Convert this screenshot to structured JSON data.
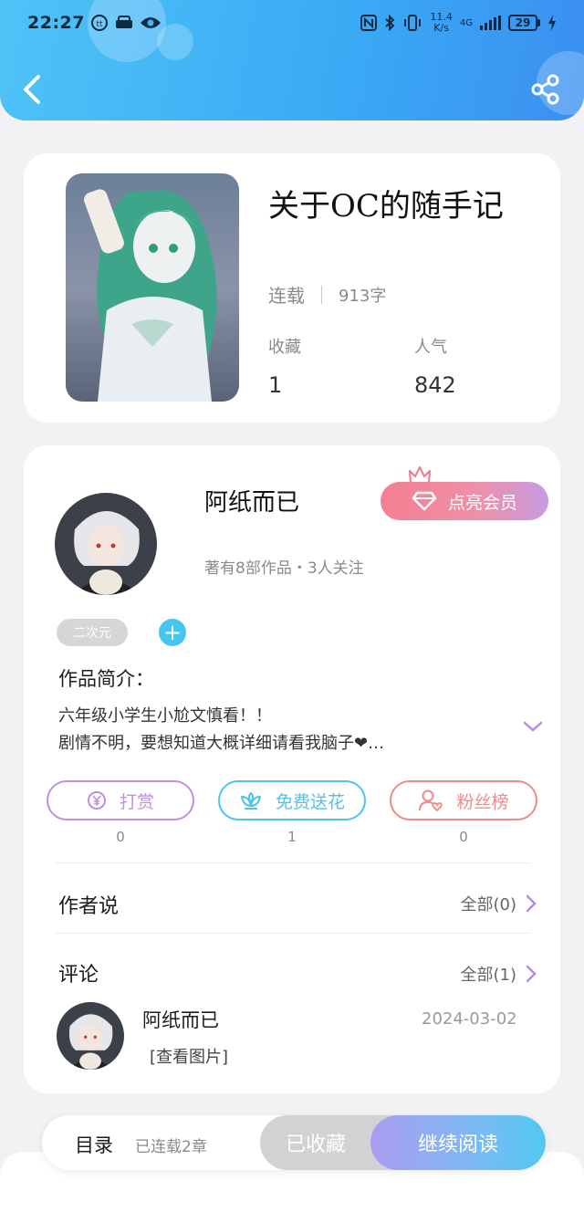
{
  "status_bar": {
    "time": "22:27",
    "net_speed_value": "11.4",
    "net_speed_unit": "K/s",
    "signal_label": "4G",
    "battery": "29"
  },
  "book": {
    "title": "关于OC的随手记",
    "status": "连载",
    "word_count": "913字",
    "favorites_label": "收藏",
    "favorites_value": "1",
    "popularity_label": "人气",
    "popularity_value": "842"
  },
  "author": {
    "name": "阿纸而已",
    "stats": "著有8部作品・3人关注",
    "vip_button": "点亮会员",
    "tag": "二次元"
  },
  "intro": {
    "title": "作品简介：",
    "line1": "六年级小学生小尬文慎看！！",
    "line2": "剧情不明，要想知道大概详细请看我脑子❤…"
  },
  "actions": [
    {
      "label": "打赏",
      "count": "0",
      "color": "#c08fe0"
    },
    {
      "label": "免费送花",
      "count": "1",
      "color": "#4cc5ec"
    },
    {
      "label": "粉丝榜",
      "count": "0",
      "color": "#f08a8a"
    }
  ],
  "author_says": {
    "title": "作者说",
    "link": "全部(0)"
  },
  "comments": {
    "title": "评论",
    "link": "全部(1)",
    "items": [
      {
        "user": "阿纸而已",
        "date": "2024-03-02",
        "body": "[查看图片]"
      }
    ]
  },
  "bottom_bar": {
    "toc": "目录",
    "toc_sub": "已连载2章",
    "collected": "已收藏",
    "continue": "继续阅读"
  },
  "colors": {
    "header_gradient_start": "#4fc3f7",
    "header_gradient_end": "#3b8ff0",
    "accent_purple": "#b58ce0",
    "vip_pink": "#f57f92",
    "tag_blue": "#46c6ef"
  },
  "icons": [
    "back-arrow-icon",
    "share-icon",
    "crown-icon",
    "diamond-icon",
    "plus-icon",
    "chevron-down-icon",
    "yen-coin-icon",
    "flower-icon",
    "fan-user-icon",
    "chevron-right-icon"
  ]
}
